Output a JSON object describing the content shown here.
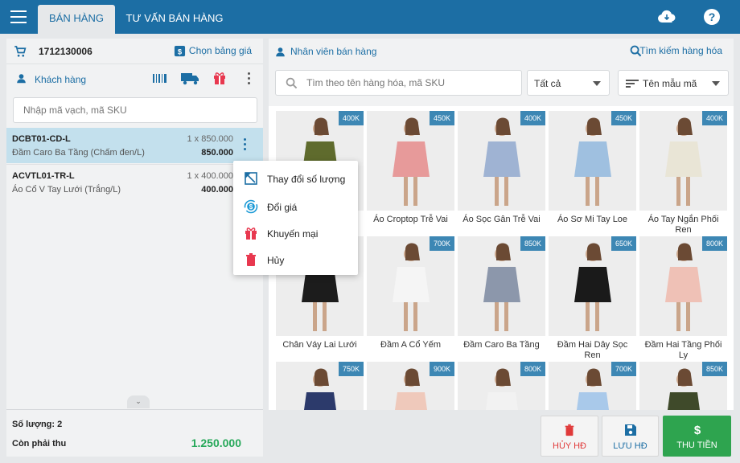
{
  "header": {
    "tabs": [
      {
        "label": "BÁN HÀNG",
        "active": true
      },
      {
        "label": "TƯ VẤN BÁN HÀNG",
        "active": false
      }
    ]
  },
  "order": {
    "id": "1712130006",
    "pricebook_label": "Chọn bảng giá",
    "customer_label": "Khách hàng",
    "scan_placeholder": "Nhập mã vạch, mã SKU"
  },
  "cart": [
    {
      "code": "DCBT01-CD-L",
      "name": "Đầm Caro Ba Tầng (Chấm đen/L)",
      "qty": "1 x 850.000",
      "price": "850.000",
      "selected": true
    },
    {
      "code": "ACVTL01-TR-L",
      "name": "Áo Cổ V Tay Lưới (Trắng/L)",
      "qty": "1 x 400.000",
      "price": "400.000",
      "selected": false
    }
  ],
  "context_menu": [
    {
      "label": "Thay đổi số lượng",
      "icon": "edit-quantity-icon"
    },
    {
      "label": "Đổi giá",
      "icon": "price-change-icon"
    },
    {
      "label": "Khuyến mại",
      "icon": "gift-icon"
    },
    {
      "label": "Hủy",
      "icon": "trash-icon"
    }
  ],
  "summary": {
    "qty_label": "Số lượng: 2",
    "due_label": "Còn phải thu",
    "due_value": "1.250.000"
  },
  "toolbar": {
    "staff_label": "Nhân viên bán hàng",
    "find_label": "Tìm kiếm hàng hóa",
    "search_placeholder": "Tìm theo tên hàng hóa, mã SKU",
    "category": "Tất cả",
    "sort": "Tên mẫu mã"
  },
  "products": [
    {
      "name": "",
      "price": "400K",
      "color": "#5f6b2d"
    },
    {
      "name": "Áo Croptop Trễ Vai",
      "price": "450K",
      "color": "#e79a9a"
    },
    {
      "name": "Áo Sọc Gân Trễ Vai",
      "price": "400K",
      "color": "#9fb3d3"
    },
    {
      "name": "Áo Sơ Mi Tay Loe",
      "price": "450K",
      "color": "#9fc0e0"
    },
    {
      "name": "Áo Tay Ngắn Phối Ren",
      "price": "400K",
      "color": "#e9e5d6"
    },
    {
      "name": "Chân Váy Lai Lưới",
      "price": "",
      "color": "#1c1c1c"
    },
    {
      "name": "Đầm A Cổ Yếm",
      "price": "700K",
      "color": "#f5f5f5"
    },
    {
      "name": "Đầm Caro Ba Tầng",
      "price": "850K",
      "color": "#8c97ab"
    },
    {
      "name": "Đầm Hai Dây Sọc Ren",
      "price": "650K",
      "color": "#1a1a1a"
    },
    {
      "name": "Đầm Hai Tầng Phối Ly",
      "price": "800K",
      "color": "#efc1b6"
    },
    {
      "name": "",
      "price": "750K",
      "color": "#2c3a6b"
    },
    {
      "name": "",
      "price": "900K",
      "color": "#efc9bb"
    },
    {
      "name": "",
      "price": "800K",
      "color": "#f2f2f2"
    },
    {
      "name": "",
      "price": "700K",
      "color": "#a9c9ea"
    },
    {
      "name": "",
      "price": "850K",
      "color": "#3f4a2a"
    }
  ],
  "actions": {
    "cancel": "HỦY HĐ",
    "save": "LƯU HĐ",
    "pay": "THU TIỀN"
  },
  "colors": {
    "brand": "#1c6ea4",
    "pay": "#2ea44f",
    "danger": "#e03a3a",
    "selected_row": "#c3e0ed"
  }
}
